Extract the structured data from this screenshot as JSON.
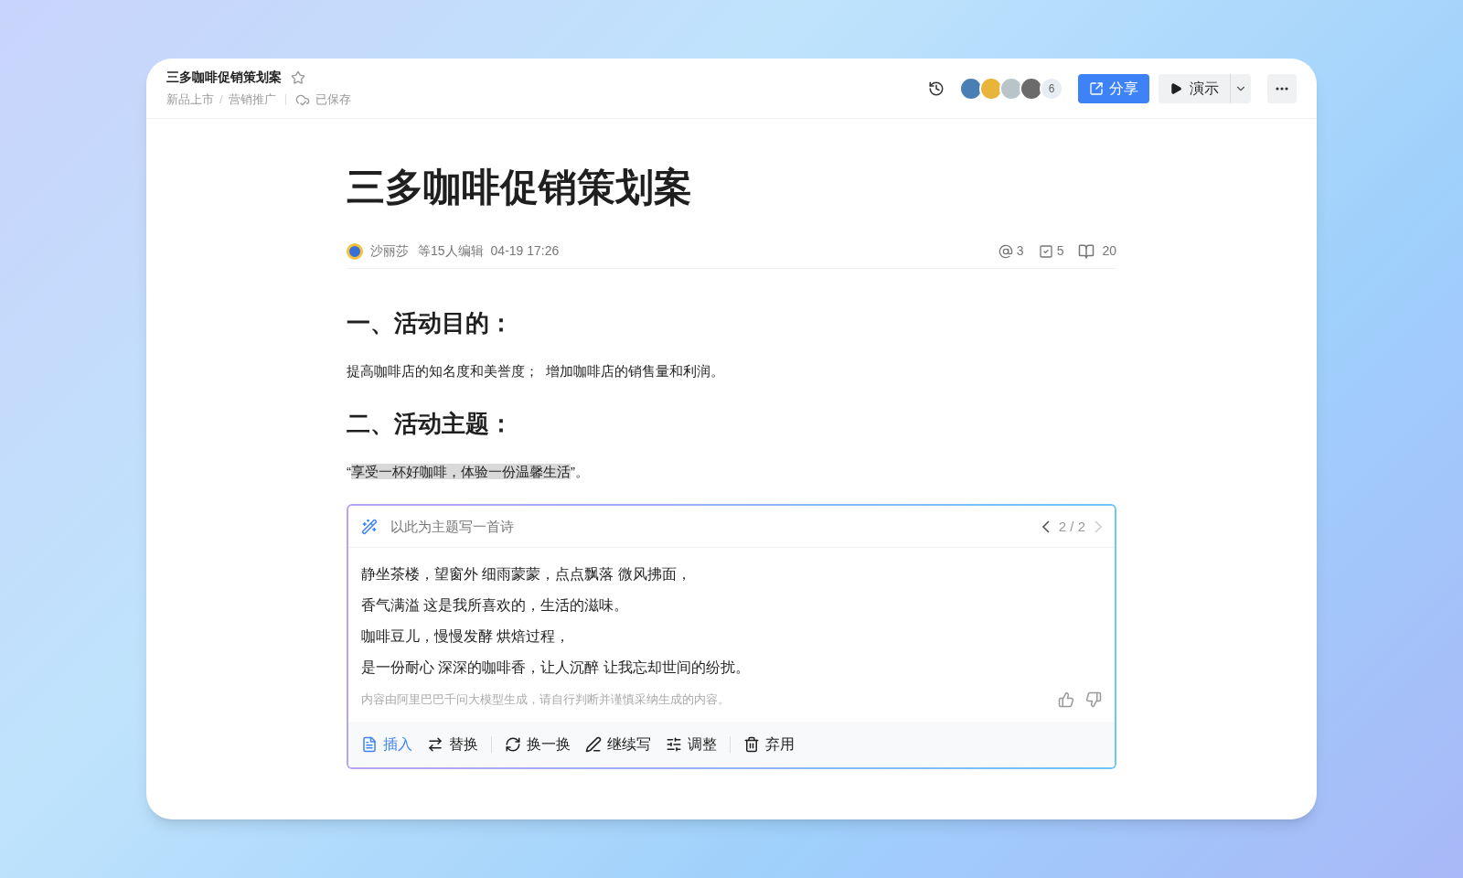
{
  "header": {
    "title": "三多咖啡促销策划案",
    "starred": false,
    "breadcrumbs": [
      "新品上市",
      "营销推广"
    ],
    "breadcrumb_separator": "/",
    "save_status": "已保存",
    "collaborators": [
      {
        "color": "#4a7fb5"
      },
      {
        "color": "#e8b53a"
      },
      {
        "color": "#b9c4c8"
      },
      {
        "color": "#6b6b6b"
      }
    ],
    "collaborator_count": "6",
    "share_label": "分享",
    "present_label": "演示"
  },
  "doc": {
    "title": "三多咖啡促销策划案",
    "author": "沙丽莎",
    "editors": "等15人编辑",
    "time": "04-19 17:26",
    "mentions": "3",
    "tasks": "5",
    "reads": "20",
    "sections": [
      {
        "heading": "一、活动目的：",
        "paragraph": {
          "before": "提高咖啡店的知名度和美誉度；  增加咖啡店的销售量和利润。"
        }
      },
      {
        "heading": "二、活动主题：",
        "paragraph": {
          "before": "“",
          "highlight": "享受一杯好咖啡，体验一份温馨生活",
          "after": "”。"
        }
      }
    ]
  },
  "ai_panel": {
    "prompt": "以此为主题写一首诗",
    "pager": "2 / 2",
    "prev_disabled": false,
    "next_disabled": true,
    "lines": [
      "静坐茶楼，望窗外 细雨蒙蒙，点点飘落 微风拂面，",
      "香气满溢 这是我所喜欢的，生活的滋味。",
      "咖啡豆儿，慢慢发酵 烘焙过程，",
      "是一份耐心 深深的咖啡香，让人沉醉 让我忘却世间的纷扰。"
    ],
    "disclaimer": "内容由阿里巴巴千问大模型生成，请自行判断并谨慎采纳生成的内容。",
    "action_groups": [
      {
        "items": [
          {
            "kind": "insert",
            "label": "插入",
            "selected": true
          },
          {
            "kind": "replace",
            "label": "替换",
            "selected": false
          }
        ]
      },
      {
        "items": [
          {
            "kind": "refresh",
            "label": "换一换",
            "selected": false
          },
          {
            "kind": "continue",
            "label": "继续写",
            "selected": false
          },
          {
            "kind": "adjust",
            "label": "调整",
            "selected": false
          }
        ]
      },
      {
        "items": [
          {
            "kind": "discard",
            "label": "弃用",
            "selected": false
          }
        ]
      }
    ]
  }
}
